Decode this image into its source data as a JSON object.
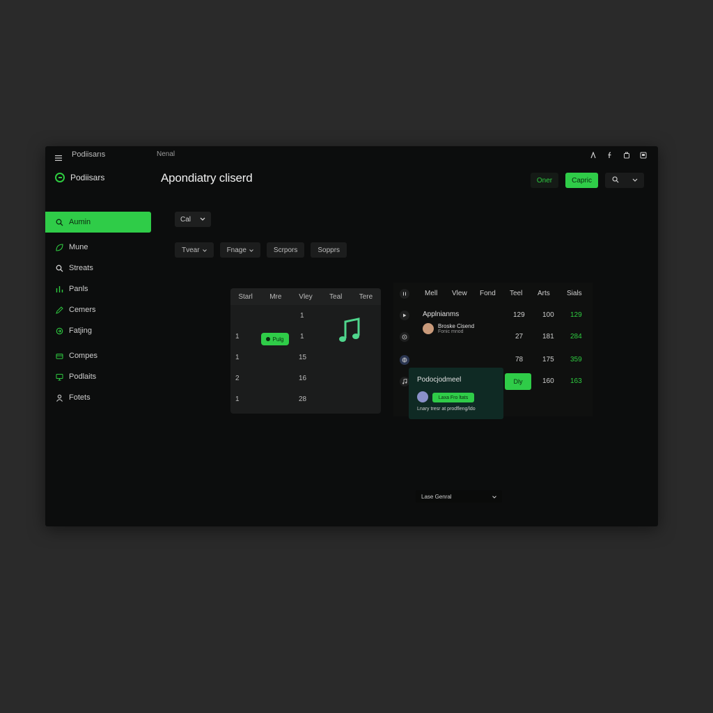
{
  "topbar": {
    "app_name": "Podiisarıs",
    "tab": "Nenal",
    "icons": [
      "user-icon",
      "facebook-icon",
      "copy-icon",
      "window-icon"
    ]
  },
  "brand": {
    "name": "Podiisars"
  },
  "sidebar": {
    "items": [
      {
        "label": "Aumin",
        "icon": "admin-icon",
        "active": true
      },
      {
        "label": "Mune",
        "icon": "leaf-icon"
      },
      {
        "label": "Streats",
        "icon": "search-icon"
      },
      {
        "label": "Panls",
        "icon": "chart-icon"
      },
      {
        "label": "Cemers",
        "icon": "edit-icon"
      },
      {
        "label": "Fatjing",
        "icon": "sync-icon"
      },
      {
        "label": "Compes",
        "icon": "wallet-icon"
      },
      {
        "label": "Podlaits",
        "icon": "monitor-icon"
      },
      {
        "label": "Fotets",
        "icon": "user-icon"
      }
    ]
  },
  "header": {
    "title": "Apondiatry cliserd",
    "btn_other": "Oner",
    "btn_primary": "Capric"
  },
  "toolbar": {
    "select_value": "Cal",
    "filters": [
      "Tvear",
      "Fnage",
      "Scrpors",
      "Sopprs"
    ]
  },
  "calendar": {
    "headers": [
      "Starl",
      "Mre",
      "Vley",
      "Teal",
      "Tere"
    ],
    "rows": [
      {
        "left": "",
        "mid": "1"
      },
      {
        "left": "1",
        "mid": "1"
      },
      {
        "left": "1",
        "mid": "15"
      },
      {
        "left": "2",
        "mid": "16"
      },
      {
        "left": "1",
        "mid": "28"
      }
    ],
    "pill_label": "Pulg"
  },
  "table": {
    "headers": [
      "Mell",
      "Vlew",
      "Fond",
      "Teel",
      "Arts",
      "Sials"
    ],
    "app_label": "Applnianms",
    "person_name": "Broske Cisend",
    "person_sub": "Fonic mnod",
    "rows": [
      {
        "icon": "play-icon",
        "a": "129",
        "b": "100",
        "c": "129"
      },
      {
        "icon": "disc-icon",
        "a": "27",
        "b": "181",
        "c": "284"
      },
      {
        "icon": "globe-icon",
        "a": "78",
        "b": "175",
        "c": "359"
      },
      {
        "icon": "music-icon",
        "a": "",
        "b": "160",
        "c": "163"
      }
    ],
    "dropdown": "Lase Genral",
    "green_btn": "Dly"
  },
  "tooltip": {
    "title": "Podocjodmeel",
    "pill": "Laxa Fro ltats",
    "caption": "Lnary tresr at prodfleng/ldo"
  },
  "colors": {
    "accent": "#2fcc48",
    "bg": "#0c0d0d"
  }
}
